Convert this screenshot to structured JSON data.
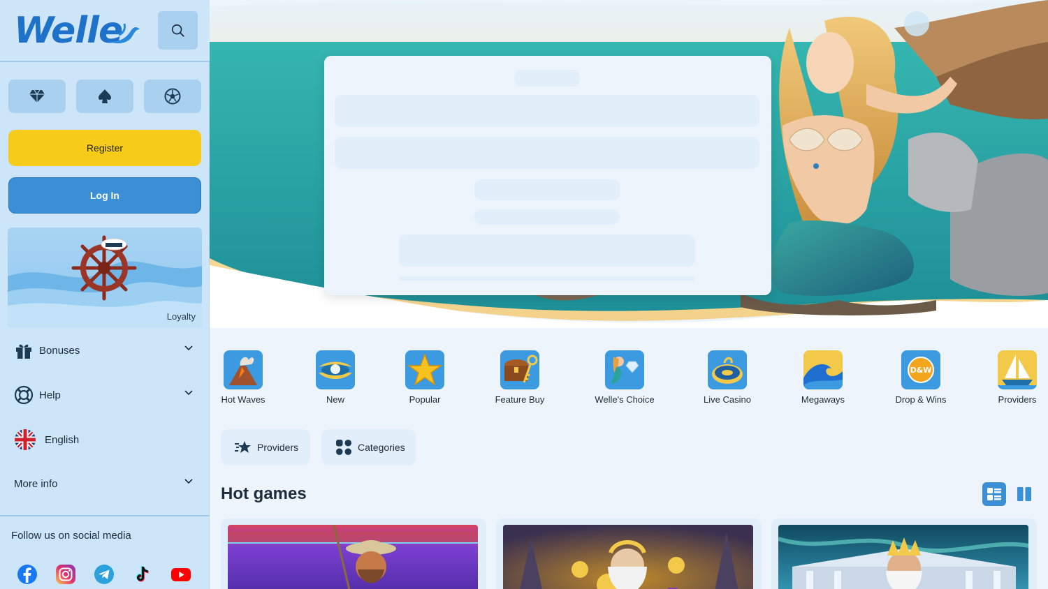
{
  "brand": {
    "logo_text": "Welle"
  },
  "colors": {
    "accent_yellow": "#f7cb19",
    "accent_blue": "#3b8fd4",
    "sidebar_bg": "#cde5f8",
    "main_bg": "#eef4fb"
  },
  "sidebar": {
    "category_buttons": [
      {
        "icon": "diamond-icon"
      },
      {
        "icon": "spade-icon"
      },
      {
        "icon": "soccer-ball-icon"
      }
    ],
    "register_label": "Register",
    "login_label": "Log In",
    "loyalty_label": "Loyalty",
    "menu": [
      {
        "label": "Bonuses",
        "icon": "gift-icon",
        "expandable": true
      },
      {
        "label": "Help",
        "icon": "lifebuoy-icon",
        "expandable": true
      },
      {
        "label": "English",
        "icon": "uk-flag-icon",
        "expandable": false
      },
      {
        "label": "More info",
        "icon": "",
        "expandable": true
      }
    ],
    "social_title": "Follow us on social media",
    "social": [
      "facebook-icon",
      "instagram-icon",
      "telegram-icon",
      "tiktok-icon",
      "youtube-icon"
    ]
  },
  "categories": [
    {
      "label": "Hot Waves",
      "icon": "volcano-icon"
    },
    {
      "label": "New",
      "icon": "pearl-icon"
    },
    {
      "label": "Popular",
      "icon": "star-icon"
    },
    {
      "label": "Feature Buy",
      "icon": "treasure-chest-icon"
    },
    {
      "label": "Welle's Choice",
      "icon": "mermaid-icon"
    },
    {
      "label": "Live Casino",
      "icon": "roulette-icon"
    },
    {
      "label": "Megaways",
      "icon": "wave-icon"
    },
    {
      "label": "Drop & Wins",
      "icon": "dw-badge-icon"
    },
    {
      "label": "Providers",
      "icon": "sailboat-icon"
    }
  ],
  "filters": {
    "providers_label": "Providers",
    "categories_label": "Categories"
  },
  "section": {
    "title": "Hot games"
  }
}
